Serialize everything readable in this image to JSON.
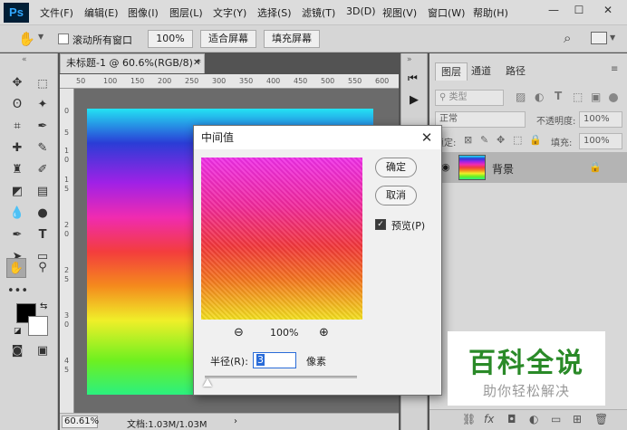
{
  "app": {
    "logo": "Ps"
  },
  "menu": [
    "文件(F)",
    "编辑(E)",
    "图像(I)",
    "图层(L)",
    "文字(Y)",
    "选择(S)",
    "滤镜(T)",
    "3D(D)",
    "视图(V)",
    "窗口(W)",
    "帮助(H)"
  ],
  "window_controls": {
    "minimize": "—",
    "maximize": "☐",
    "close": "✕"
  },
  "options": {
    "scroll_all_label": "滚动所有窗口",
    "zoom_value": "100%",
    "fit_screen": "适合屏幕",
    "fill_screen": "填充屏幕"
  },
  "document": {
    "tab_title": "未标题-1 @ 60.6%(RGB/8) *",
    "zoom_status": "60.61%",
    "doc_info": "文档:1.03M/1.03M",
    "ruler_top": [
      "50",
      "100",
      "150",
      "200",
      "250",
      "300",
      "350",
      "400",
      "450",
      "500",
      "550",
      "600"
    ],
    "ruler_left": [
      "0",
      "5",
      "1",
      "0",
      "1",
      "5",
      "2",
      "0",
      "2",
      "5",
      "3",
      "0",
      "4",
      "5"
    ]
  },
  "layers_panel": {
    "tabs": [
      "图层",
      "通道",
      "路径"
    ],
    "filter_kind": "类型",
    "blend_mode": "正常",
    "opacity_label": "不透明度:",
    "opacity_value": "100%",
    "lock_label": "锁定:",
    "fill_label": "填充:",
    "fill_value": "100%",
    "layer_name": "背景"
  },
  "dialog": {
    "title": "中间值",
    "ok": "确定",
    "cancel": "取消",
    "preview_label": "预览(P)",
    "preview_checked": true,
    "zoom": "100%",
    "radius_label": "半径(R):",
    "radius_value": "3",
    "unit": "像素",
    "slider_position": 0.02
  },
  "watermark": {
    "title": "百科全说",
    "subtitle": "助你轻松解决"
  }
}
